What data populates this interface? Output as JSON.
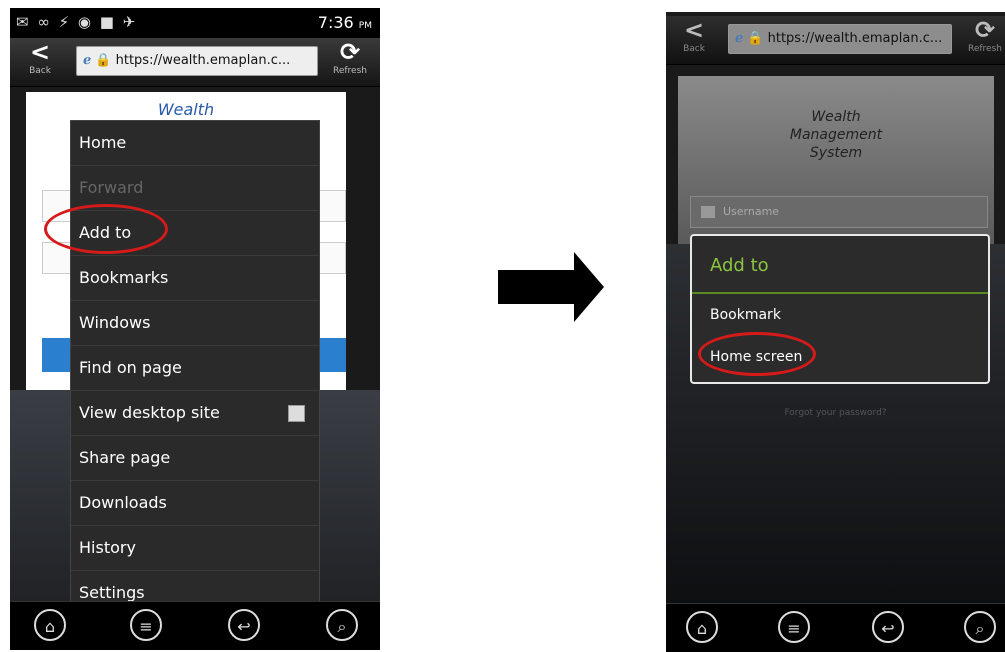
{
  "left_phone": {
    "status_time": "7:36",
    "status_ampm": "PM",
    "status_icons": "✉ ∞ ⚡ ◉ ■ ✈",
    "back_label": "Back",
    "refresh_label": "Refresh",
    "url": "https://wealth.emaplan.c...",
    "page_title": "Wealth",
    "menu_items": [
      {
        "label": "Home"
      },
      {
        "label": "Forward"
      },
      {
        "label": "Add to"
      },
      {
        "label": "Bookmarks"
      },
      {
        "label": "Windows"
      },
      {
        "label": "Find on page"
      },
      {
        "label": "View desktop site"
      },
      {
        "label": "Share page"
      },
      {
        "label": "Downloads"
      },
      {
        "label": "History"
      },
      {
        "label": "Settings"
      }
    ]
  },
  "right_phone": {
    "back_label": "Back",
    "refresh_label": "Refresh",
    "url": "https://wealth.emaplan.c...",
    "title_line1": "Wealth",
    "title_line2": "Management",
    "title_line3": "System",
    "username_placeholder": "Username",
    "dialog_title": "Add to",
    "dialog_items": [
      {
        "label": "Bookmark"
      },
      {
        "label": "Home screen"
      }
    ],
    "forgot_text": "Forgot your password?"
  },
  "colors": {
    "highlight_circle": "#d51a1a",
    "dialog_title": "#8cc63f",
    "login_button": "#2b7fcf"
  }
}
